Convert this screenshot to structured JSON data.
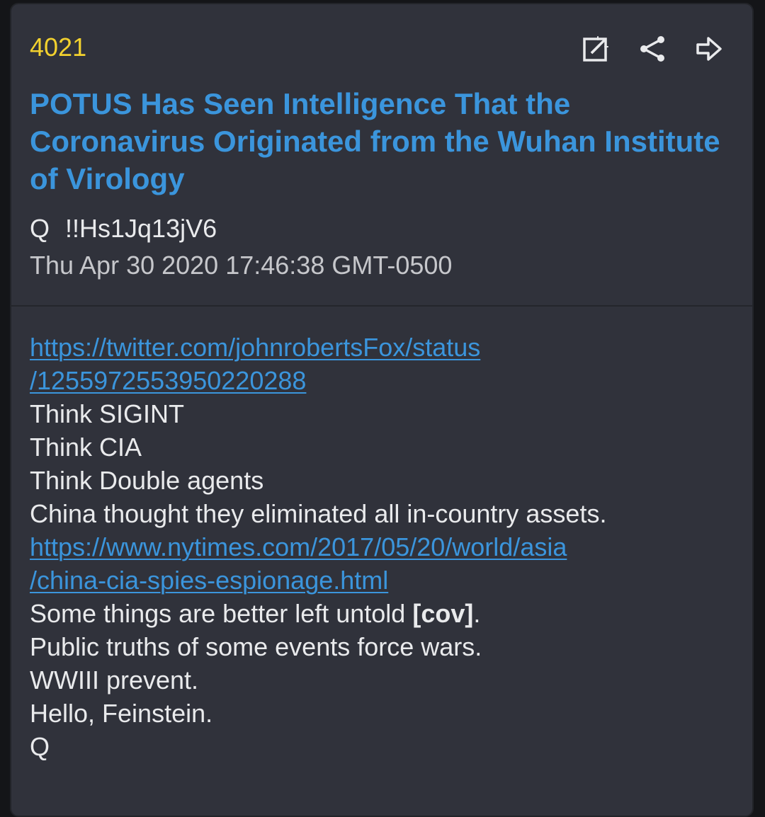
{
  "post": {
    "number": "4021",
    "title": "POTUS Has Seen Intelligence That the Coronavirus Originated from the Wuhan Institute of Virology",
    "author_name": "Q",
    "tripcode": "!!Hs1Jq13jV6",
    "timestamp": "Thu Apr 30 2020 17:46:38 GMT-0500"
  },
  "actions": {
    "open_icon": "open-external-icon",
    "share_icon": "share-icon",
    "forward_icon": "forward-arrow-icon"
  },
  "body": {
    "link1_part1": "https://twitter.com/johnrobertsFox/status",
    "link1_part2": "/1255972553950220288",
    "line1": "Think SIGINT",
    "line2": "Think CIA",
    "line3": "Think Double agents",
    "line4": "China thought they eliminated all in-country assets.",
    "link2_part1": "https://www.nytimes.com/2017/05/20/world/asia",
    "link2_part2": "/china-cia-spies-espionage.html",
    "line5_prefix": "Some things are better left untold ",
    "line5_bracket": "[cov]",
    "line5_suffix": ".",
    "line6": "Public truths of some events force wars.",
    "line7": "WWIII prevent.",
    "line8": "Hello, Feinstein.",
    "signature": "Q"
  },
  "colors": {
    "card_bg": "#30323b",
    "number": "#f2d12e",
    "link": "#3b95dc",
    "text": "#e9eaec"
  }
}
